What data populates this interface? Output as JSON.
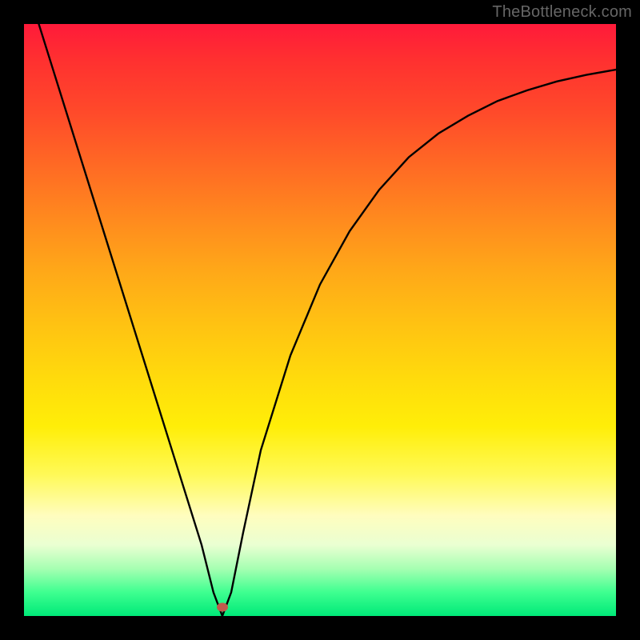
{
  "watermark": "TheBottleneck.com",
  "marker": {
    "x_pct": 33.5,
    "y_pct": 98.5
  },
  "chart_data": {
    "type": "line",
    "title": "",
    "xlabel": "",
    "ylabel": "",
    "xlim": [
      0,
      100
    ],
    "ylim": [
      0,
      100
    ],
    "grid": false,
    "legend": false,
    "series": [
      {
        "name": "bottleneck-curve",
        "x": [
          0,
          5,
          10,
          15,
          20,
          25,
          30,
          32,
          33.5,
          35,
          37,
          40,
          45,
          50,
          55,
          60,
          65,
          70,
          75,
          80,
          85,
          90,
          95,
          100
        ],
        "y": [
          108,
          92,
          76,
          60,
          44,
          28,
          12,
          4,
          0,
          4,
          14,
          28,
          44,
          56,
          65,
          72,
          77.5,
          81.5,
          84.5,
          87,
          88.8,
          90.3,
          91.4,
          92.3
        ]
      }
    ],
    "annotations": [
      {
        "type": "marker",
        "x": 33.5,
        "y": 0,
        "shape": "ellipse",
        "color": "#c15a4d"
      }
    ],
    "background_gradient": {
      "direction": "top-to-bottom",
      "stops": [
        {
          "pct": 0,
          "color": "#ff1a3a"
        },
        {
          "pct": 50,
          "color": "#ffc312"
        },
        {
          "pct": 80,
          "color": "#fffdbe"
        },
        {
          "pct": 100,
          "color": "#00e978"
        }
      ]
    }
  }
}
